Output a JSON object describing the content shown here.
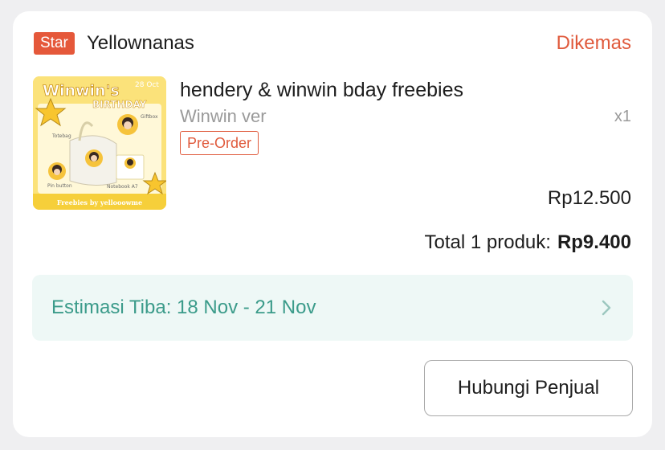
{
  "shop": {
    "badge": "Star",
    "name": "Yellownanas",
    "status": "Dikemas"
  },
  "product": {
    "title": "hendery & winwin bday freebies",
    "variant": "Winwin ver",
    "quantity": "x1",
    "tag": "Pre-Order",
    "price": "Rp12.500",
    "thumbnail": {
      "headline": "Winwin's",
      "subhead": "BIRTHDAY",
      "date": "28 Oct",
      "labels": [
        "Totebag",
        "Giftbox",
        "Pin button",
        "Notebook A7"
      ],
      "footer": "Freebies by yellooowme"
    }
  },
  "summary": {
    "total_label": "Total 1 produk:",
    "total_amount": "Rp9.400"
  },
  "shipping": {
    "eta": "Estimasi Tiba: 18 Nov - 21 Nov"
  },
  "actions": {
    "contact_label": "Hubungi Penjual"
  },
  "colors": {
    "accent": "#e05a3c",
    "eta_bg": "#eef8f6",
    "eta_text": "#3b9b8a",
    "thumb_yellow": "#fbe27a"
  }
}
